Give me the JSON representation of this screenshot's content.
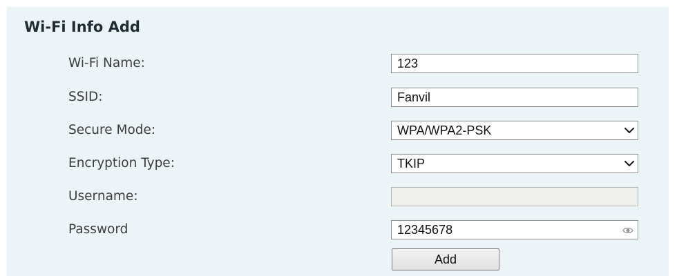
{
  "section": {
    "title": "Wi-Fi Info Add"
  },
  "form": {
    "wifi_name": {
      "label": "Wi-Fi Name:",
      "value": "123"
    },
    "ssid": {
      "label": "SSID:",
      "value": "Fanvil"
    },
    "secure_mode": {
      "label": "Secure Mode:",
      "value": "WPA/WPA2-PSK"
    },
    "encryption_type": {
      "label": "Encryption Type:",
      "value": "TKIP"
    },
    "username": {
      "label": "Username:",
      "value": ""
    },
    "password": {
      "label": "Password",
      "value": "12345678",
      "icon": "eye-icon"
    },
    "add_label": "Add"
  },
  "colors": {
    "panel_background": "#edf4f8",
    "input_border": "#8c8c8c",
    "disabled_input_background": "#efefec",
    "label_text": "#3d3d3d",
    "title_text": "#1f2a33"
  }
}
